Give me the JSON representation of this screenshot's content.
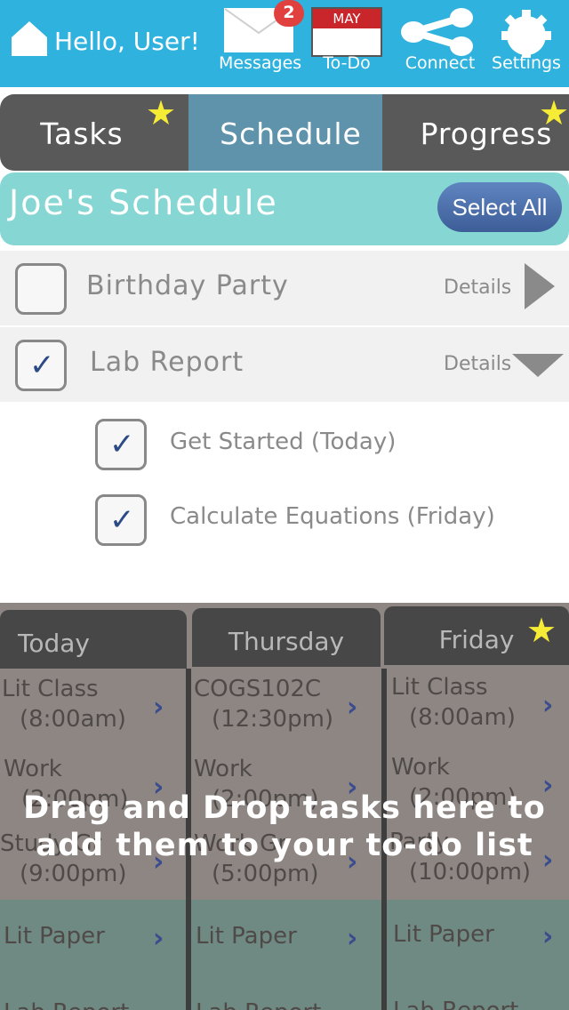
{
  "header": {
    "greeting": "Hello, User!",
    "nav": [
      {
        "label": "Messages",
        "icon": "envelope-icon",
        "badge": "2"
      },
      {
        "label": "To-Do",
        "icon": "calendar-icon",
        "calendar_month": "MAY"
      },
      {
        "label": "Connect",
        "icon": "share-icon"
      },
      {
        "label": "Settings",
        "icon": "gear-icon"
      }
    ]
  },
  "tabs": [
    {
      "label": "Tasks",
      "starred": true
    },
    {
      "label": "Schedule",
      "active": true
    },
    {
      "label": "Progress",
      "starred": true
    }
  ],
  "schedule": {
    "title": "Joe's Schedule",
    "select_all_label": "Select All",
    "tasks": [
      {
        "label": "Birthday Party",
        "checked": false,
        "details_label": "Details",
        "expanded": false
      },
      {
        "label": "Lab Report",
        "checked": true,
        "details_label": "Details",
        "expanded": true,
        "subtasks": [
          {
            "label": "Get Started (Today)",
            "checked": true
          },
          {
            "label": "Calculate Equations (Friday)",
            "checked": true
          }
        ]
      }
    ]
  },
  "calendar": {
    "columns": [
      {
        "day": "Today",
        "starred": false,
        "cells": [
          {
            "name": "Lit Class",
            "time": "(8:00am)"
          },
          {
            "name": "Work",
            "time": "(2:00pm)"
          },
          {
            "name": "Study Gr",
            "time": "(9:00pm)"
          },
          {
            "name": "Lit Paper",
            "time": ""
          },
          {
            "name": "Lab Report",
            "time": ""
          }
        ]
      },
      {
        "day": "Thursday",
        "starred": false,
        "cells": [
          {
            "name": "COGS102C",
            "time": "(12:30pm)"
          },
          {
            "name": "Work",
            "time": "(2:00pm)"
          },
          {
            "name": "Work Gr",
            "time": "(5:00pm)"
          },
          {
            "name": "Lit Paper",
            "time": ""
          },
          {
            "name": "Lab Report",
            "time": ""
          }
        ]
      },
      {
        "day": "Friday",
        "starred": true,
        "cells": [
          {
            "name": "Lit Class",
            "time": "(8:00am)"
          },
          {
            "name": "Work",
            "time": "(2:00pm)"
          },
          {
            "name": "Party",
            "time": "(10:00pm)"
          },
          {
            "name": "Lit Paper",
            "time": ""
          },
          {
            "name": "Lab Report",
            "time": ""
          }
        ]
      }
    ],
    "overlay_line1": "Drag and Drop tasks here to",
    "overlay_line2": "add them to your to-do list"
  },
  "colors": {
    "topbar": "#2fb2de",
    "tab_active": "#5e93ab",
    "tab_inactive": "#595959",
    "schedule_header": "#86d6d4",
    "select_all": "#4a6fae",
    "star": "#f7ec35",
    "badge": "#e0413f"
  }
}
